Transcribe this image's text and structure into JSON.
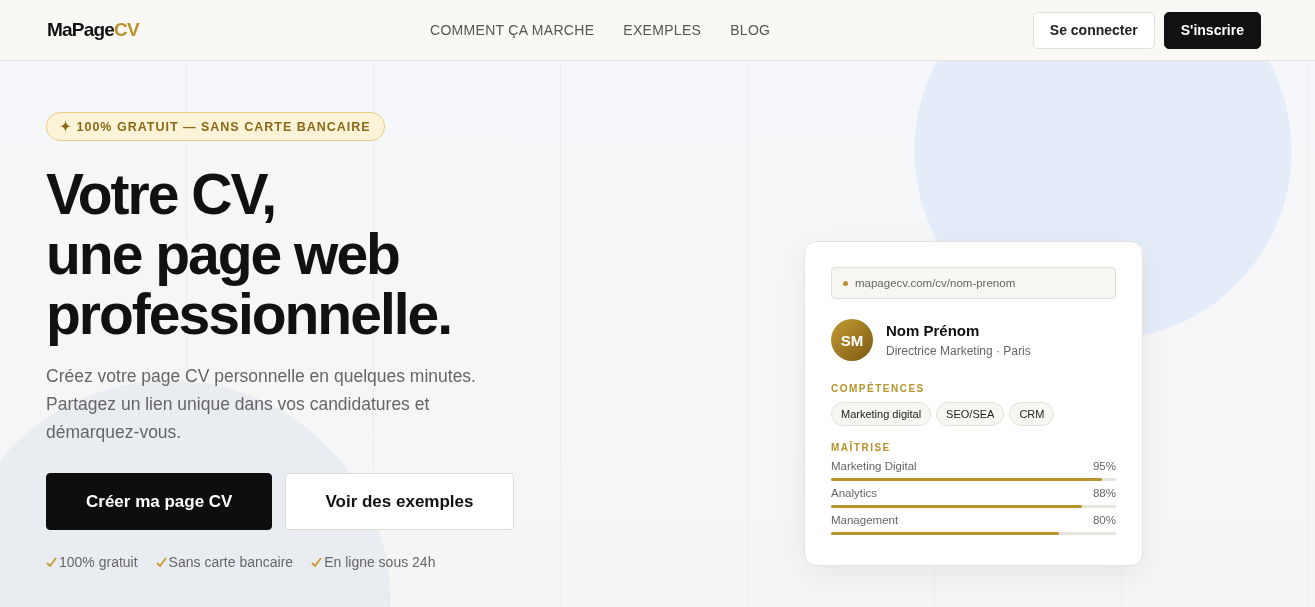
{
  "logo": {
    "main": "MaPage",
    "accent": "CV"
  },
  "nav": {
    "links": [
      "COMMENT ÇA MARCHE",
      "EXEMPLES",
      "BLOG"
    ],
    "login": "Se connecter",
    "signup": "S'inscrire"
  },
  "hero": {
    "badge": "✦ 100% GRATUIT — SANS CARTE BANCAIRE",
    "title": [
      "Votre CV,",
      "une page web",
      "professionnelle."
    ],
    "subtitle": "Créez votre page CV personnelle en quelques minutes. Partagez un lien unique dans vos candidatures et démarquez-vous.",
    "primary": "Créer ma page CV",
    "secondary": "Voir des exemples",
    "perks": [
      "100% gratuit",
      "Sans carte bancaire",
      "En ligne sous 24h"
    ]
  },
  "card": {
    "url": "mapagecv.com/cv/nom-prenom",
    "initials": "SM",
    "name": "Nom Prénom",
    "role": "Directrice Marketing · Paris",
    "skills_title": "COMPÉTENCES",
    "skills": [
      "Marketing digital",
      "SEO/SEA",
      "CRM"
    ],
    "mastery_title": "MAÎTRISE",
    "mastery": [
      {
        "label": "Marketing Digital",
        "reading": "95%",
        "level": 0.95
      },
      {
        "label": "Analytics",
        "reading": "88%",
        "level": 0.88
      },
      {
        "label": "Management",
        "reading": "80%",
        "level": 0.8
      }
    ]
  }
}
